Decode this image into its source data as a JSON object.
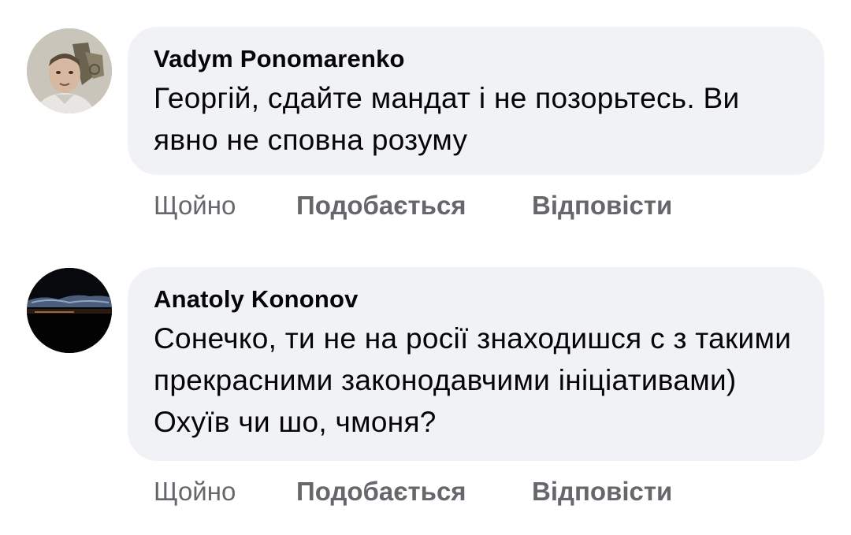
{
  "comments": [
    {
      "author": "Vadym Ponomarenko",
      "text": "Георгій, сдайте мандат і не позорьтесь. Ви явно не сповна розуму",
      "time": "Щойно",
      "like_label": "Подобається",
      "reply_label": "Відповісти",
      "avatar_icon": "user-photo-avatar"
    },
    {
      "author": "Anatoly Kononov",
      "text": "Сонечко, ти не на росії знаходишся с з такими прекрасними законодавчими ініціативами) Охуїв чи шо, чмоня?",
      "time": "Щойно",
      "like_label": "Подобається",
      "reply_label": "Відповісти",
      "avatar_icon": "night-sky-avatar"
    }
  ],
  "colors": {
    "bubble_bg": "#f0f2f5",
    "text": "#050505",
    "meta": "#65676b",
    "page_bg": "#ffffff"
  }
}
